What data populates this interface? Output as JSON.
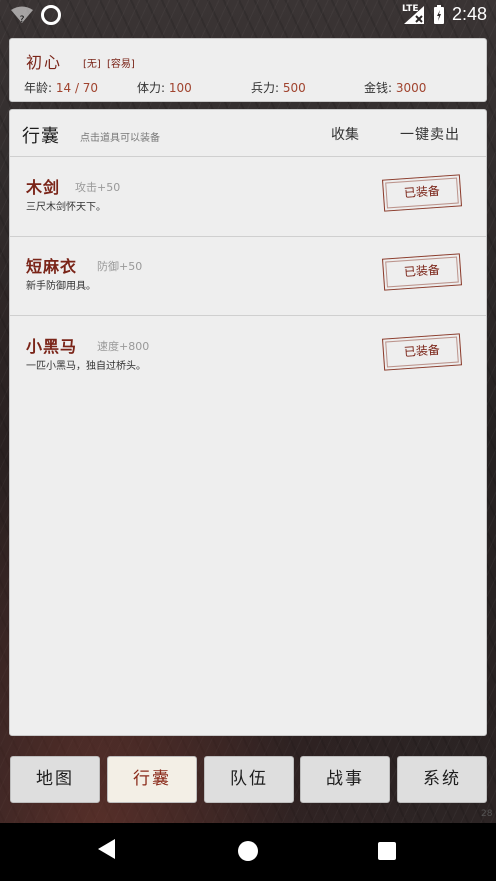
{
  "status_bar": {
    "network": "LTE",
    "time": "2:48"
  },
  "player": {
    "name": "初心",
    "tag1": "[无]",
    "tag2": "[容易]",
    "age_label": "年龄: ",
    "age_value": "14 / 70",
    "hp_label": "体力: ",
    "hp_value": "100",
    "troop_label": "兵力: ",
    "troop_value": "500",
    "money_label": "金钱: ",
    "money_value": "3000"
  },
  "panel": {
    "title": "行囊",
    "hint": "点击道具可以装备",
    "collect_label": "收集",
    "sell_all_label": "一键卖出"
  },
  "items": [
    {
      "name": "木剑",
      "attr": "攻击+50",
      "desc": "三尺木剑怀天下。",
      "button": "已装备"
    },
    {
      "name": "短麻衣",
      "attr": "防御+50",
      "desc": "新手防御用具。",
      "button": "已装备"
    },
    {
      "name": "小黑马",
      "attr": "速度+800",
      "desc": "一匹小黑马，独自过桥头。",
      "button": "已装备"
    }
  ],
  "nav": {
    "map": "地图",
    "bag": "行囊",
    "team": "队伍",
    "battle": "战事",
    "system": "系统",
    "active": "bag"
  },
  "corner_number": "28",
  "colors": {
    "accent": "#7a2418",
    "value": "#a0432e",
    "panel_bg": "#eeeeee"
  }
}
